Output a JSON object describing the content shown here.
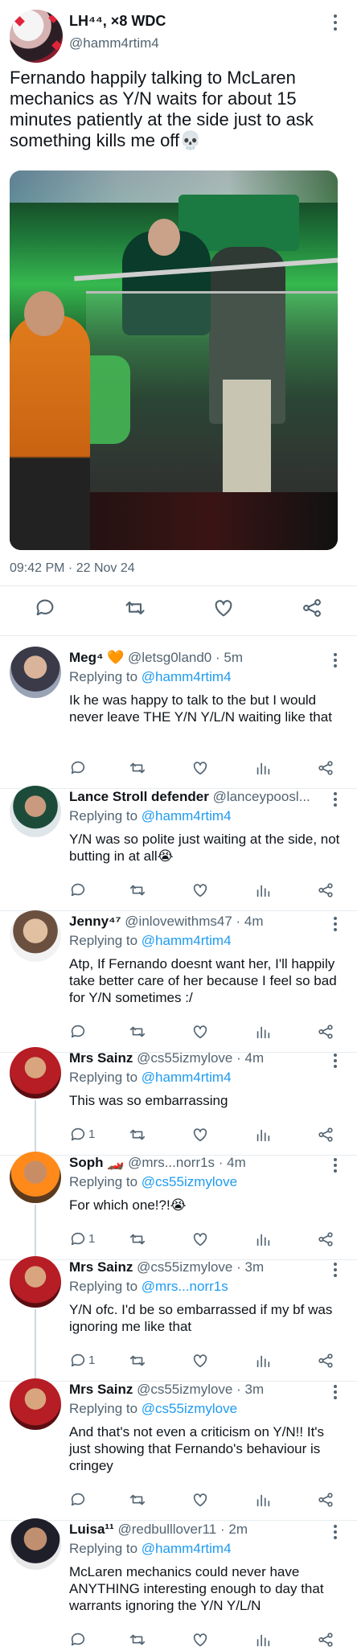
{
  "main_tweet": {
    "display_name": "LH⁴⁴, ×8 WDC",
    "handle": "@hamm4rtim4",
    "text": "Fernando happily talking to McLaren mechanics as Y/N waits for about 15 minutes patiently at the side just to ask something kills me off💀",
    "timestamp": "09:42 PM · 22 Nov 24",
    "actions": [
      "reply-icon",
      "retweet-icon",
      "like-icon",
      "share-icon"
    ]
  },
  "replies": [
    {
      "display_name": "Meg⁴ 🧡",
      "handle": "@letsg0land0 · 5m",
      "replying_label": "Replying to",
      "replying_to": "@hamm4rtim4",
      "text": "Ik he was happy to talk to the but I would never leave THE Y/N Y/L/N waiting like that",
      "reply_count": ""
    },
    {
      "display_name": "Lance Stroll defender",
      "handle": "@lanceypoosl...",
      "replying_label": "Replying to",
      "replying_to": "@hamm4rtim4",
      "text": "Y/N was so polite just waiting at the side, not butting in at all😭",
      "reply_count": ""
    },
    {
      "display_name": "Jenny⁴⁷",
      "handle": "@inlovewithms47 · 4m",
      "replying_label": "Replying to",
      "replying_to": "@hamm4rtim4",
      "text": "Atp, If Fernando doesnt want her, I'll happily take better care of her because I feel so bad for Y/N sometimes :/",
      "reply_count": ""
    },
    {
      "display_name": "Mrs Sainz",
      "handle": "@cs55izmylove · 4m",
      "replying_label": "Replying to",
      "replying_to": "@hamm4rtim4",
      "text": "This was so embarrassing",
      "reply_count": "1"
    },
    {
      "display_name": "Soph 🏎️",
      "handle": "@mrs...norr1s · 4m",
      "replying_label": "Replying to",
      "replying_to": "@cs55izmylove",
      "text": "For which one!?!😭",
      "reply_count": "1"
    },
    {
      "display_name": "Mrs Sainz",
      "handle": "@cs55izmylove · 3m",
      "replying_label": "Replying to",
      "replying_to": "@mrs...norr1s",
      "text": "Y/N ofc. I'd be so embarrassed if my bf was ignoring me like that",
      "reply_count": "1"
    },
    {
      "display_name": "Mrs Sainz",
      "handle": "@cs55izmylove · 3m",
      "replying_label": "Replying to",
      "replying_to": "@cs55izmylove",
      "text": "And that's not even a criticism on Y/N!! It's just showing that Fernando's behaviour is cringey",
      "reply_count": ""
    },
    {
      "display_name": "Luisa¹¹",
      "handle": "@redbulllover11 · 2m",
      "replying_label": "Replying to",
      "replying_to": "@hamm4rtim4",
      "text": "McLaren mechanics could never have ANYTHING interesting enough to day that warrants ignoring the Y/N Y/L/N",
      "reply_count": ""
    }
  ],
  "colors": {
    "link": "#1d9bf0",
    "secondary": "#536471",
    "divider": "#e6ecf0"
  }
}
